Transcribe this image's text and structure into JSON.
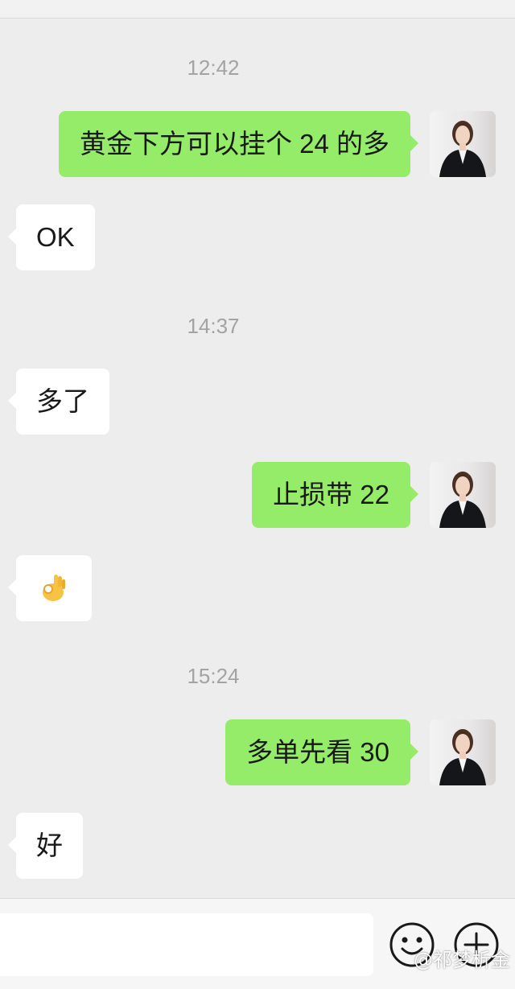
{
  "theme": {
    "background": "#ededed",
    "sent_bubble": "#95ec69",
    "received_bubble": "#ffffff",
    "timestamp_color": "#a3a3a3"
  },
  "messages": {
    "ts1": "12:42",
    "m1": "黄金下方可以挂个 24 的多",
    "m2": "OK",
    "ts2": "14:37",
    "m3": "多了",
    "m4": "止损带 22",
    "m5_icon": "ok-hand-emoji",
    "ts3": "15:24",
    "m6": "多单先看 30",
    "m7": "好"
  },
  "input_bar": {
    "emoji_icon": "smiley-face-icon",
    "more_icon": "plus-circle-icon"
  },
  "watermark": "@祁梦析金"
}
